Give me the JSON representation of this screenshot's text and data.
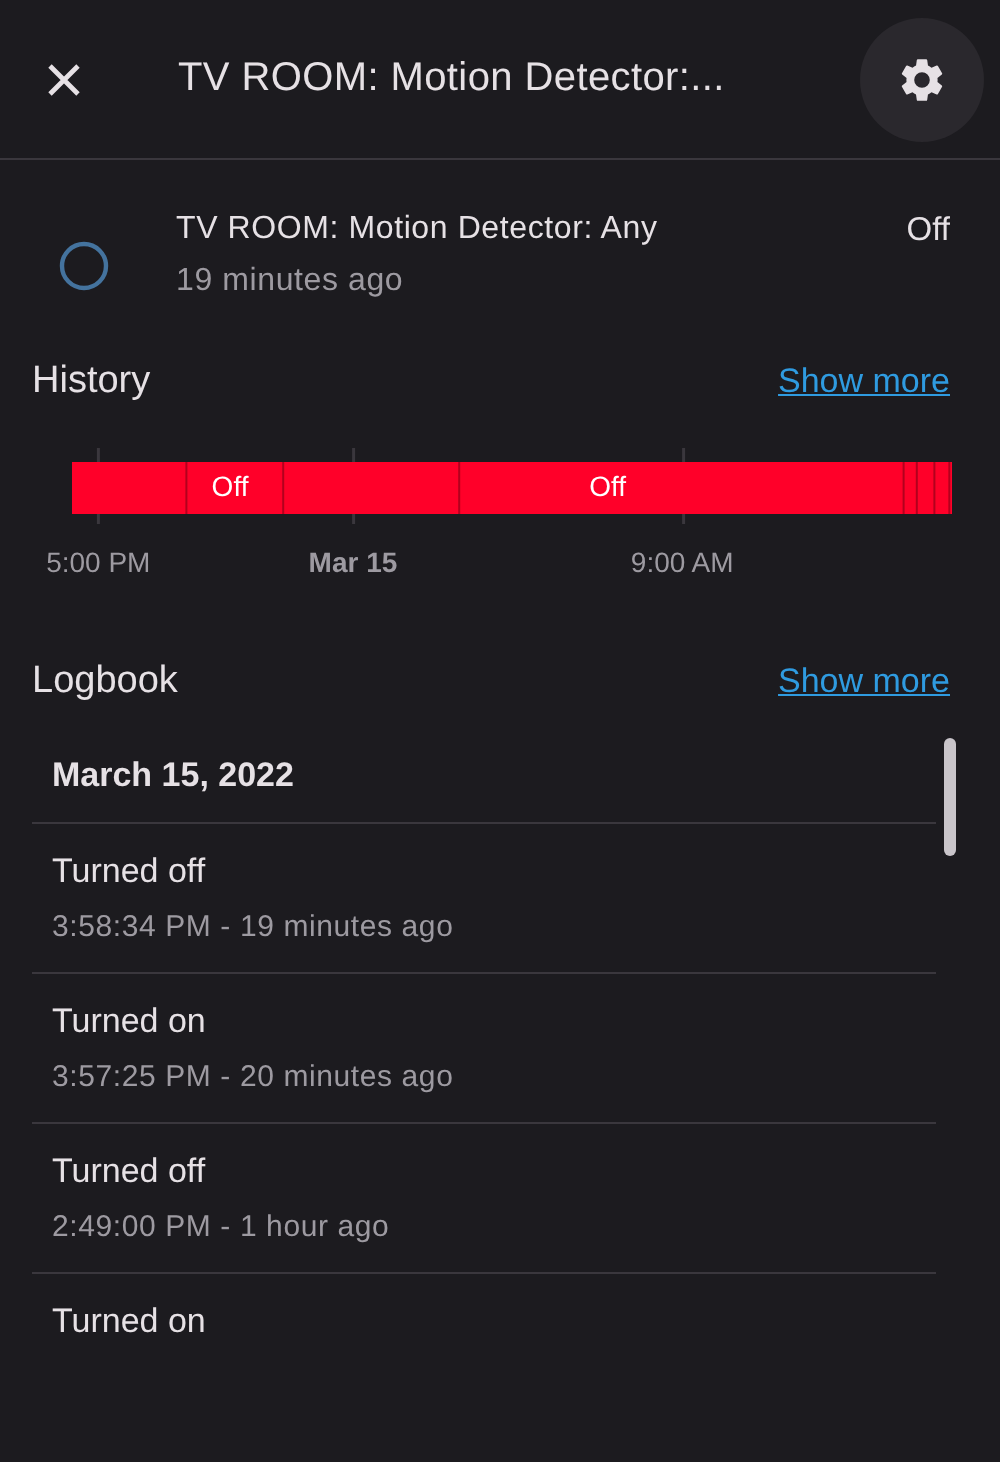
{
  "header": {
    "title": "TV ROOM: Motion Detector:..."
  },
  "entity": {
    "name": "TV ROOM: Motion Detector: Any",
    "changed": "19 minutes ago",
    "state": "Off",
    "on": false
  },
  "history": {
    "title": "History",
    "link": "Show more",
    "bar_labels": [
      "Off",
      "Off"
    ],
    "axis_labels": [
      {
        "text": "5:00 PM",
        "bold": false
      },
      {
        "text": "Mar 15",
        "bold": true
      },
      {
        "text": "9:00 AM",
        "bold": false
      }
    ]
  },
  "logbook": {
    "title": "Logbook",
    "link": "Show more",
    "date": "March 15, 2022",
    "entries": [
      {
        "message": "Turned off",
        "time": "3:58:34 PM - 19 minutes ago"
      },
      {
        "message": "Turned on",
        "time": "3:57:25 PM - 20 minutes ago"
      },
      {
        "message": "Turned off",
        "time": "2:49:00 PM - 1 hour ago"
      },
      {
        "message": "Turned on"
      }
    ]
  }
}
